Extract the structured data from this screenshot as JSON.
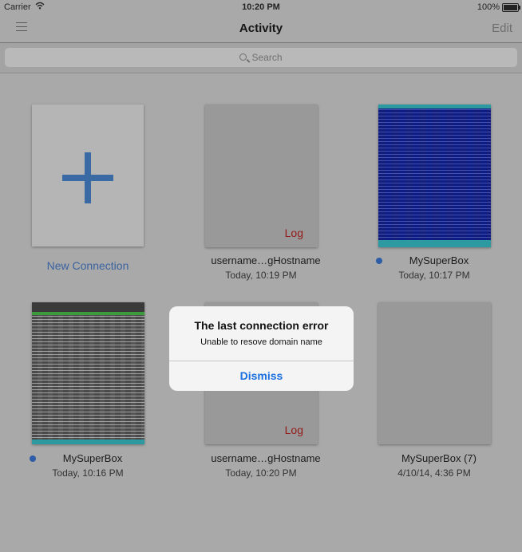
{
  "status_bar": {
    "carrier": "Carrier",
    "time": "10:20 PM",
    "battery": "100%"
  },
  "nav": {
    "title": "Activity",
    "edit": "Edit"
  },
  "search": {
    "placeholder": "Search"
  },
  "cards": [
    {
      "label": "New Connection"
    },
    {
      "label": "username…gHostname",
      "time": "Today, 10:19 PM",
      "badge": "Log"
    },
    {
      "label": "MySuperBox",
      "time": "Today, 10:17 PM"
    },
    {
      "label": "MySuperBox",
      "time": "Today, 10:16 PM"
    },
    {
      "label": "username…gHostname",
      "time": "Today, 10:20 PM",
      "badge": "Log"
    },
    {
      "label": "MySuperBox (7)",
      "time": "4/10/14, 4:36 PM"
    }
  ],
  "alert": {
    "title": "The last connection error",
    "message": "Unable to resove domain name",
    "button": "Dismiss"
  },
  "colors": {
    "accent": "#3a62a0",
    "alert_button": "#1a6fe0",
    "log_text": "#931b18",
    "dot": "#2c5da6"
  }
}
